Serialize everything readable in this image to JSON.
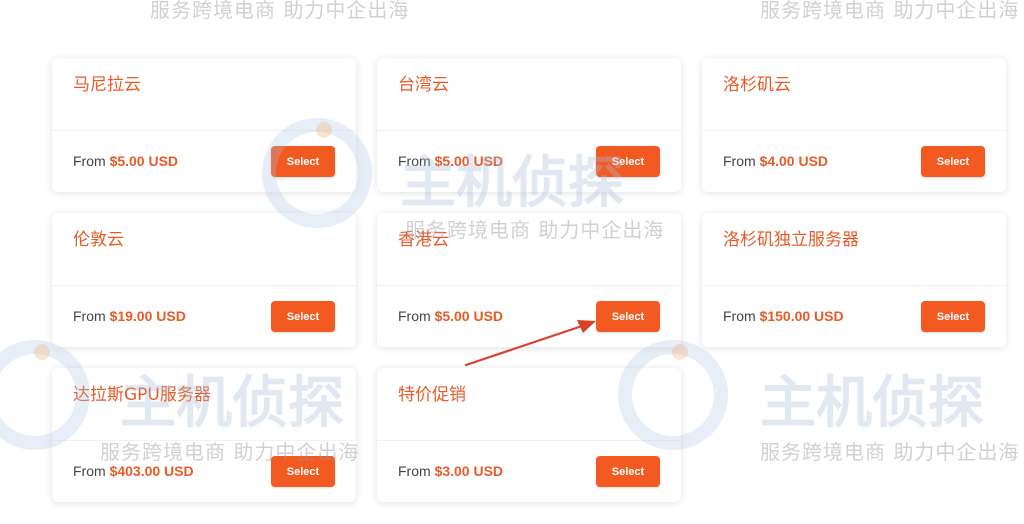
{
  "accent_color": "#f25a22",
  "title_color": "#e95a27",
  "cards": [
    {
      "title": "马尼拉云",
      "from_label": "From",
      "price": "$5.00 USD",
      "button_label": "Select"
    },
    {
      "title": "台湾云",
      "from_label": "From",
      "price": "$5.00 USD",
      "button_label": "Select"
    },
    {
      "title": "洛杉矶云",
      "from_label": "From",
      "price": "$4.00 USD",
      "button_label": "Select"
    },
    {
      "title": "伦敦云",
      "from_label": "From",
      "price": "$19.00 USD",
      "button_label": "Select"
    },
    {
      "title": "香港云",
      "from_label": "From",
      "price": "$5.00 USD",
      "button_label": "Select"
    },
    {
      "title": "洛杉矶独立服务器",
      "from_label": "From",
      "price": "$150.00 USD",
      "button_label": "Select"
    },
    {
      "title": "达拉斯GPU服务器",
      "from_label": "From",
      "price": "$403.00 USD",
      "button_label": "Select"
    },
    {
      "title": "特价促销",
      "from_label": "From",
      "price": "$3.00 USD",
      "button_label": "Select"
    }
  ],
  "watermark": {
    "slogan": "服务跨境电商  助力中企出海",
    "brand": "主机侦探"
  },
  "annotation": {
    "arrow_icon": "red-arrow-icon",
    "target": "香港云 Select"
  }
}
